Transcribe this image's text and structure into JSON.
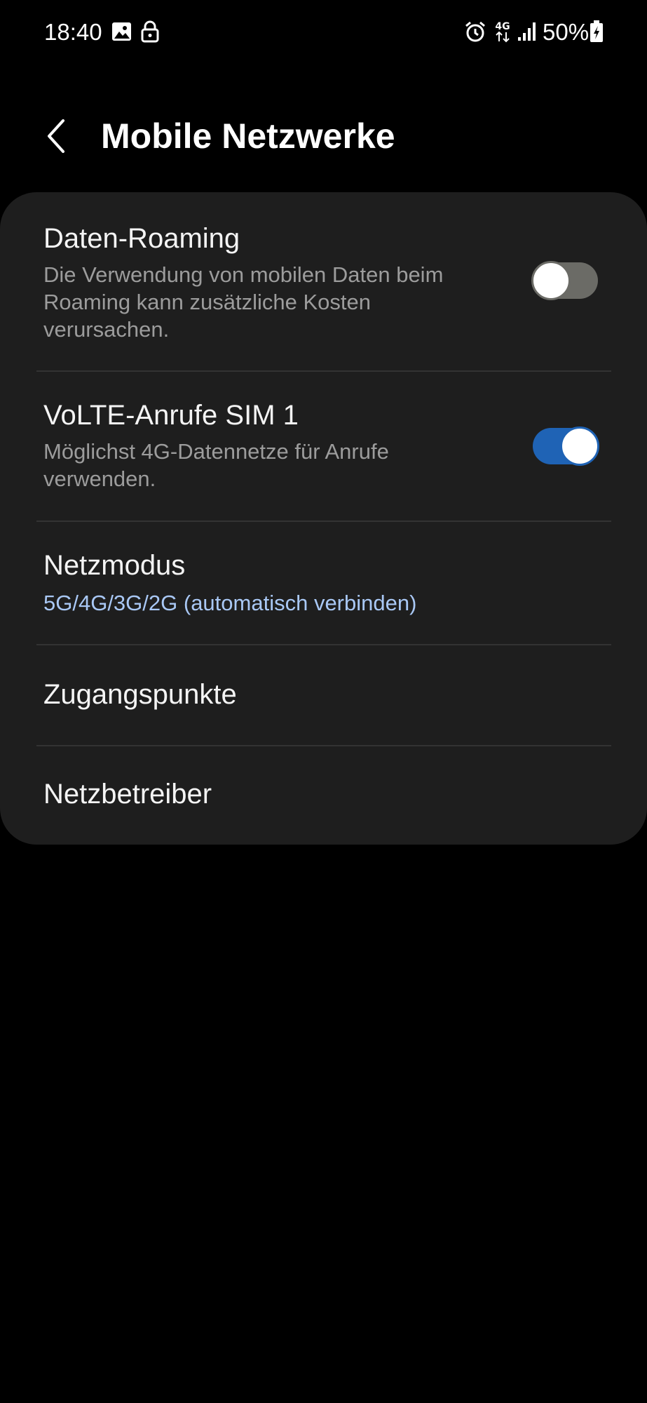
{
  "status_bar": {
    "time": "18:40",
    "battery_text": "50%",
    "icons": [
      "image-icon",
      "lock-icon",
      "alarm-icon",
      "network-4g-icon",
      "signal-icon",
      "battery-charging-icon"
    ],
    "network_label": "4G"
  },
  "header": {
    "back_icon": "chevron-left-icon",
    "title": "Mobile Netzwerke"
  },
  "settings": {
    "data_roaming": {
      "title": "Daten-Roaming",
      "description": "Die Verwendung von mobilen Daten beim Roaming kann zusätzliche Kosten verursachen.",
      "enabled": false
    },
    "volte": {
      "title": "VoLTE-Anrufe SIM 1",
      "description": "Möglichst 4G-Datennetze für Anrufe verwenden.",
      "enabled": true
    },
    "network_mode": {
      "title": "Netzmodus",
      "value": "5G/4G/3G/2G (automatisch verbinden)"
    },
    "access_points": {
      "title": "Zugangspunkte"
    },
    "network_operators": {
      "title": "Netzbetreiber"
    }
  },
  "colors": {
    "background": "#000000",
    "card": "#1e1e1e",
    "accent": "#1f63b5",
    "value_text": "#a9c8f5",
    "secondary_text": "#9c9c9c"
  }
}
